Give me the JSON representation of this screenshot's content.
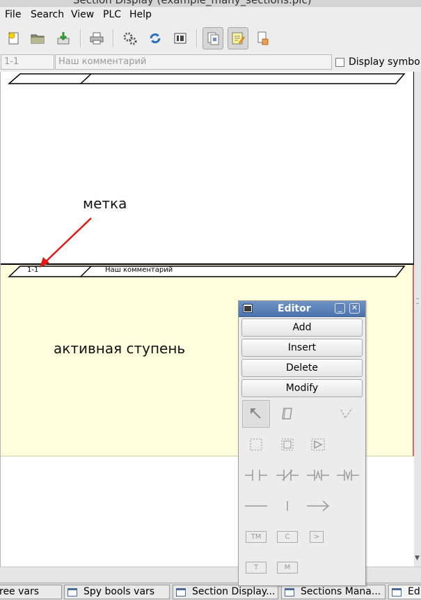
{
  "window": {
    "title": "Section Display (example_many_sections.plc)"
  },
  "menu": [
    "File",
    "Search",
    "View",
    "PLC",
    "Help"
  ],
  "toolbar": {
    "icons": [
      "new-file-icon",
      "open-folder-icon",
      "save-icon",
      "print-icon",
      "gears-icon",
      "refresh-icon",
      "io-list-icon",
      "sections-manager-icon",
      "editor-icon",
      "symbols-icon"
    ]
  },
  "component_bar": {
    "label_field": "1-1",
    "comment_field": "Наш комментарий",
    "display_symbols_label": "Display symbols"
  },
  "sections": [
    {
      "label": "",
      "comment": ""
    },
    {
      "label": "1-1",
      "comment": "Наш комментарий"
    }
  ],
  "annotations": {
    "marker_label": "метка",
    "active_rung_label": "активная ступень",
    "arrow_color": "#e01818"
  },
  "editor": {
    "title": "Editor",
    "buttons": [
      "Add",
      "Insert",
      "Delete",
      "Modify"
    ],
    "tools": {
      "row1": [
        "pointer-icon",
        "eraser-icon",
        "connector-icon"
      ],
      "row2": [
        "select-area-icon",
        "select-block-icon",
        "element-select-icon"
      ],
      "row3": [
        "contact-no-icon",
        "contact-nc-icon",
        "contact-rising-icon",
        "contact-falling-icon"
      ],
      "row4": [
        "h-line-icon",
        "v-line-icon",
        "arrow-line-icon"
      ],
      "labels": [
        "TM",
        "C",
        ">",
        "T",
        "M"
      ]
    }
  },
  "taskbar": [
    "ree vars",
    "Spy bools vars",
    "Section Display...",
    "Sections Mana...",
    "Ed"
  ],
  "colors": {
    "active_section_bg": "#ffffdd",
    "active_border": "#e06565",
    "editor_titlebar": "#5a80b8"
  }
}
